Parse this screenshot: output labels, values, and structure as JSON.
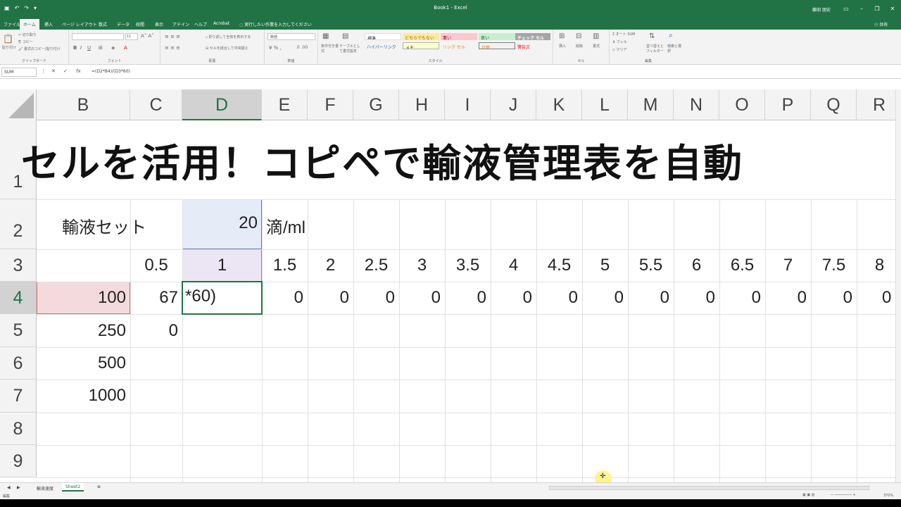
{
  "titlebar": {
    "title": "Book1 - Excel",
    "user": "藤田 朋宏",
    "share": "共有"
  },
  "tabs": [
    "ファイル",
    "ホーム",
    "挿入",
    "ページ レイアウト",
    "数式",
    "データ",
    "校閲",
    "表示",
    "アドイン",
    "ヘルプ",
    "Acrobat",
    "実行したい作業を入力してください"
  ],
  "ribbon": {
    "groups": [
      "クリップボード",
      "フォント",
      "配置",
      "数値",
      "スタイル",
      "セル",
      "編集"
    ],
    "clipboard": [
      "貼り付け",
      "切り取り",
      "コピー",
      "書式のコピー/貼り付け"
    ],
    "alignment": [
      "折り返して全体を表示する",
      "セルを結合して中央揃え"
    ],
    "number_format": "数値",
    "styles_left": [
      "条件付き書式",
      "テーブルとして書式設定"
    ],
    "styles": [
      "標準",
      "どちらでもない",
      "悪い",
      "良い",
      "チェック セル",
      "ハイパーリンク",
      "メモ",
      "リンク セル",
      "計算",
      "警告文"
    ],
    "cells": [
      "挿入",
      "削除",
      "書式"
    ],
    "editing": [
      "オート SUM",
      "フィル",
      "クリア",
      "並べ替えとフィルター",
      "検索と選択"
    ]
  },
  "formula_bar": {
    "name_box": "SUM",
    "formula": "=(D2*B4)/(D3*60)"
  },
  "columns": [
    "B",
    "C",
    "D",
    "E",
    "F",
    "G",
    "H",
    "I",
    "J",
    "K",
    "L",
    "M",
    "N",
    "O",
    "P",
    "Q",
    "R"
  ],
  "rows": [
    "1",
    "2",
    "3",
    "4",
    "5",
    "6",
    "7",
    "8",
    "9"
  ],
  "sheet": {
    "title": "セルを活用！コピペで輸液管理表を自動",
    "b2": "輸液セット",
    "d2": "20",
    "e2": "滴/ml",
    "row3": [
      "0.5",
      "1",
      "1.5",
      "2",
      "2.5",
      "3",
      "3.5",
      "4",
      "4.5",
      "5",
      "5.5",
      "6",
      "6.5",
      "7",
      "7.5",
      "8"
    ],
    "b_values": [
      "100",
      "250",
      "500",
      "1000"
    ],
    "c4": "67",
    "d4": "*60)",
    "row4_rest": [
      "0",
      "0",
      "0",
      "0",
      "0",
      "0",
      "0",
      "0",
      "0",
      "0",
      "0",
      "0",
      "0",
      "0"
    ],
    "c5": "0"
  },
  "sheet_tabs": [
    "輸液速度",
    "Sheet2"
  ],
  "status": {
    "mode": "編集",
    "zoom": "370%"
  },
  "colors": {
    "accent": "#217346",
    "selected_fill": "#e6ebf8",
    "d3_fill": "#ece6f4",
    "b4_fill": "#f5dadd"
  }
}
